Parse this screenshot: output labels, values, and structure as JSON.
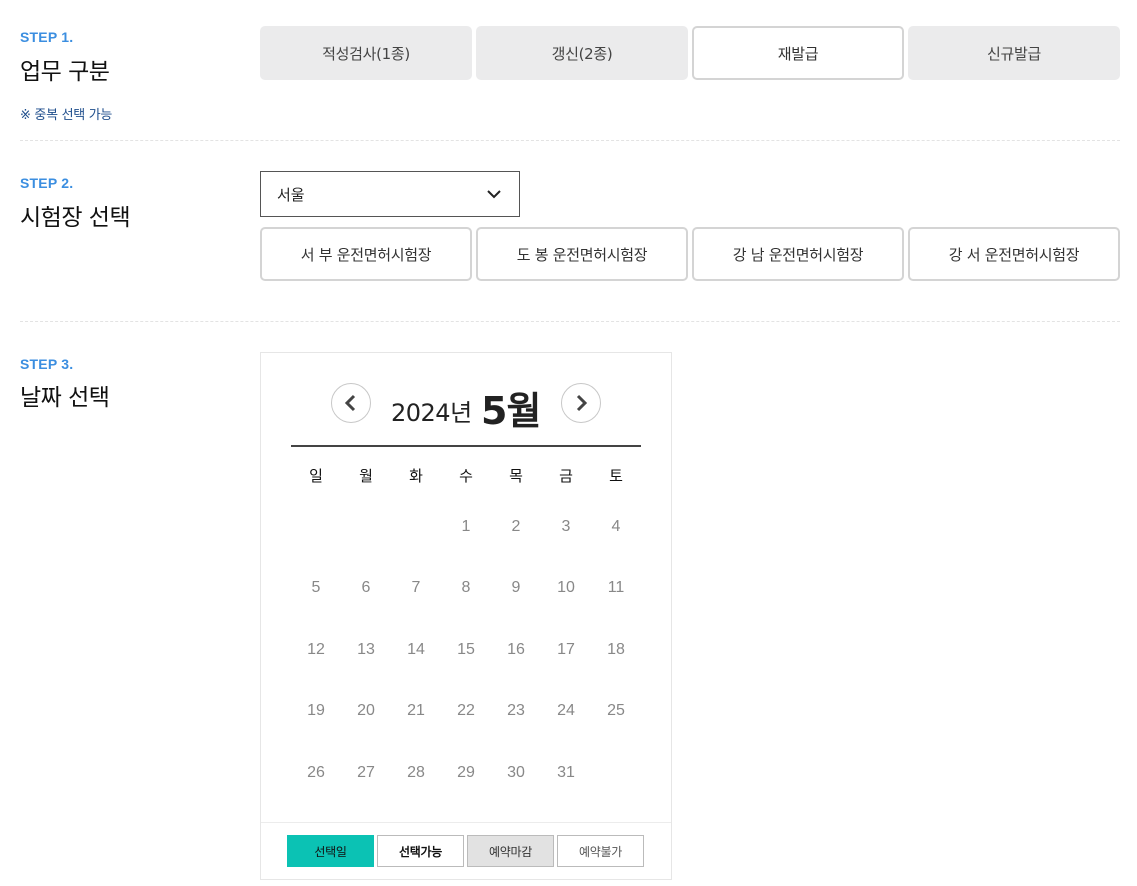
{
  "step1": {
    "label": "STEP 1.",
    "title": "업무 구분",
    "note": "※ 중복 선택 가능",
    "buttons": [
      "적성검사(1종)",
      "갱신(2종)",
      "재발급",
      "신규발급"
    ]
  },
  "step2": {
    "label": "STEP 2.",
    "title": "시험장 선택",
    "region": "서울",
    "centers": [
      "서 부 운전면허시험장",
      "도 봉 운전면허시험장",
      "강 남 운전면허시험장",
      "강 서 운전면허시험장"
    ]
  },
  "step3": {
    "label": "STEP 3.",
    "title": "날짜 선택"
  },
  "calendar": {
    "year": "2024년",
    "month": "5월",
    "weekdays": [
      "일",
      "월",
      "화",
      "수",
      "목",
      "금",
      "토"
    ],
    "days": [
      "",
      "",
      "",
      "1",
      "2",
      "3",
      "4",
      "5",
      "6",
      "7",
      "8",
      "9",
      "10",
      "11",
      "12",
      "13",
      "14",
      "15",
      "16",
      "17",
      "18",
      "19",
      "20",
      "21",
      "22",
      "23",
      "24",
      "25",
      "26",
      "27",
      "28",
      "29",
      "30",
      "31",
      ""
    ],
    "legend": {
      "selected": "선택일",
      "available": "선택가능",
      "closed": "예약마감",
      "unavailable": "예약불가"
    }
  },
  "colors": {
    "accent": "#3b8ee0",
    "selected": "#0bc2b4",
    "closed": "#e2e2e2"
  }
}
